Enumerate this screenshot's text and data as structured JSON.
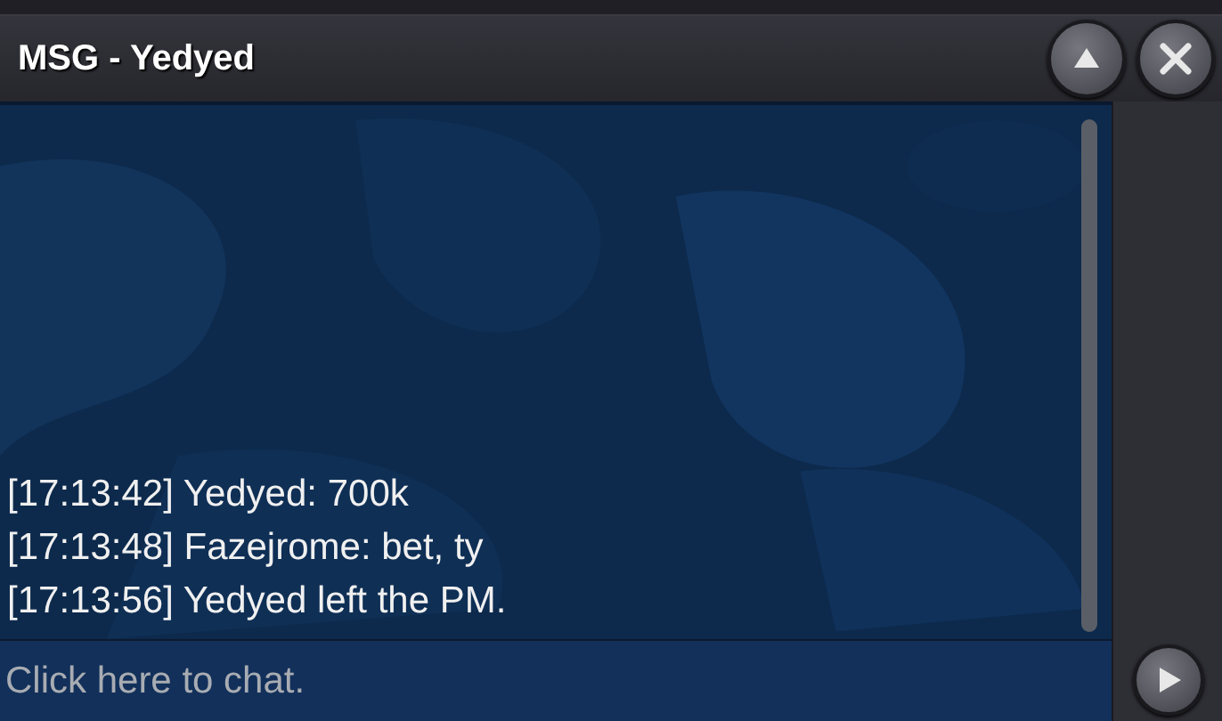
{
  "window": {
    "title": "MSG - Yedyed"
  },
  "messages": [
    {
      "text": "[17:13:42] Yedyed: 700k"
    },
    {
      "text": "[17:13:48] Fazejrome: bet, ty"
    },
    {
      "text": "[17:13:56] Yedyed left the PM."
    }
  ],
  "input": {
    "placeholder": "Click here to chat."
  }
}
